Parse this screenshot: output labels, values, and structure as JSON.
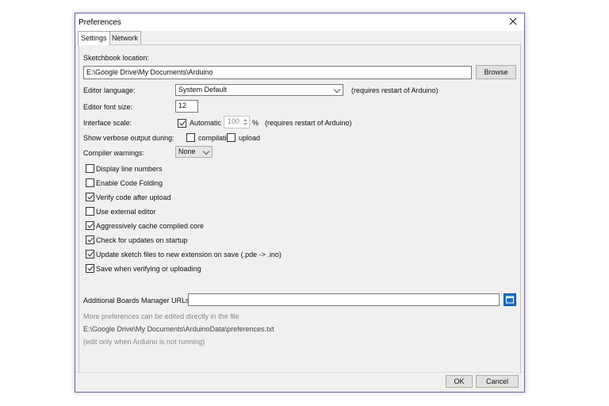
{
  "window": {
    "title": "Preferences"
  },
  "tabs": [
    {
      "label": "Settings"
    },
    {
      "label": "Network"
    }
  ],
  "sketchbook": {
    "label": "Sketchbook location:",
    "value": "E:\\Google Drive\\My Documents\\Arduino",
    "browse_label": "Browse"
  },
  "editor_language": {
    "label": "Editor language:",
    "value": "System Default",
    "note": "(requires restart of Arduino)"
  },
  "font_size": {
    "label": "Editor font size:",
    "value": "12"
  },
  "interface_scale": {
    "label": "Interface scale:",
    "auto_label": "Automatic",
    "auto_checked": true,
    "value": "100",
    "unit": "%",
    "note": "(requires restart of Arduino)"
  },
  "verbose": {
    "label": "Show verbose output during:",
    "compilation_label": "compilation",
    "compilation_checked": false,
    "upload_label": "upload",
    "upload_checked": false
  },
  "compiler_warnings": {
    "label": "Compiler warnings:",
    "value": "None"
  },
  "options": [
    {
      "label": "Display line numbers",
      "checked": false
    },
    {
      "label": "Enable Code Folding",
      "checked": false
    },
    {
      "label": "Verify code after upload",
      "checked": true
    },
    {
      "label": "Use external editor",
      "checked": false
    },
    {
      "label": "Aggressively cache compiled core",
      "checked": true
    },
    {
      "label": "Check for updates on startup",
      "checked": true
    },
    {
      "label": "Update sketch files to new extension on save (.pde -> .ino)",
      "checked": true
    },
    {
      "label": "Save when verifying or uploading",
      "checked": true
    }
  ],
  "boards_urls": {
    "label": "Additional Boards Manager URLs:",
    "value": ""
  },
  "info": {
    "line1": "More preferences can be edited directly in the file",
    "line2": "E:\\Google Drive\\My Documents\\ArduinoData\\preferences.txt",
    "line3": "(edit only when Arduino is not running)"
  },
  "footer": {
    "ok_label": "OK",
    "cancel_label": "Cancel"
  },
  "colors": {
    "accent": "#1e6fc7",
    "border": "#7b5fa8"
  },
  "icons": {
    "close": "close-icon",
    "url_editor": "window-edit-icon"
  }
}
